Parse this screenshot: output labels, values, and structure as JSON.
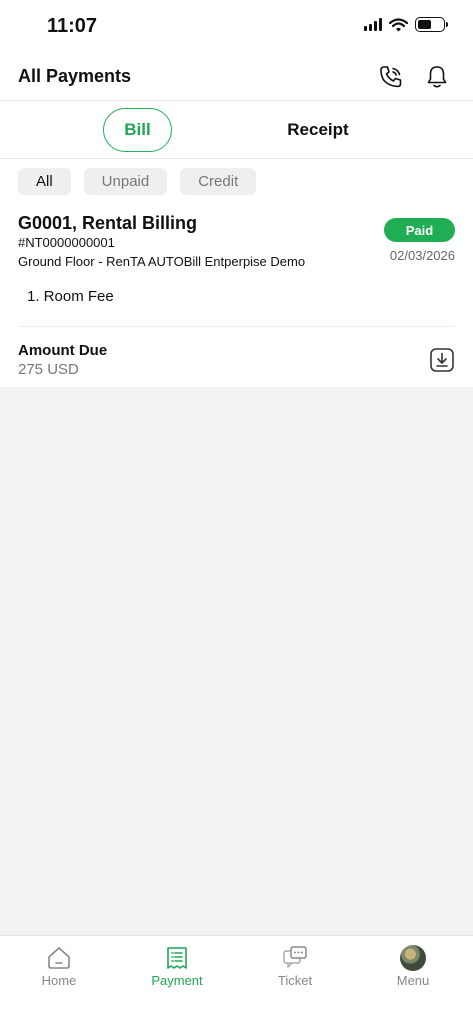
{
  "status_bar": {
    "time": "11:07"
  },
  "header": {
    "title": "All Payments",
    "phone_icon": "phone-icon",
    "bell_icon": "bell-icon"
  },
  "tabs": [
    {
      "label": "Bill",
      "active": true
    },
    {
      "label": "Receipt",
      "active": false
    }
  ],
  "filters": [
    {
      "label": "All",
      "active": true
    },
    {
      "label": "Unpaid",
      "active": false
    },
    {
      "label": "Credit",
      "active": false
    }
  ],
  "bill": {
    "title": "G0001, Rental Billing",
    "number": "#NT0000000001",
    "location": "Ground Floor - RenTA AUTOBill Entperpise Demo",
    "status": "Paid",
    "date": "02/03/2026",
    "items": [
      "1. Room Fee"
    ],
    "amount_label": "Amount Due",
    "amount_value": "275 USD"
  },
  "bottom_nav": [
    {
      "label": "Home",
      "icon": "home-icon",
      "active": false
    },
    {
      "label": "Payment",
      "icon": "receipt-icon",
      "active": true
    },
    {
      "label": "Ticket",
      "icon": "ticket-chat-icon",
      "active": false
    },
    {
      "label": "Menu",
      "icon": "avatar",
      "active": false
    }
  ],
  "colors": {
    "accent": "#1fa656",
    "badge_paid": "#1fae54",
    "background": "#f3f3f3"
  }
}
